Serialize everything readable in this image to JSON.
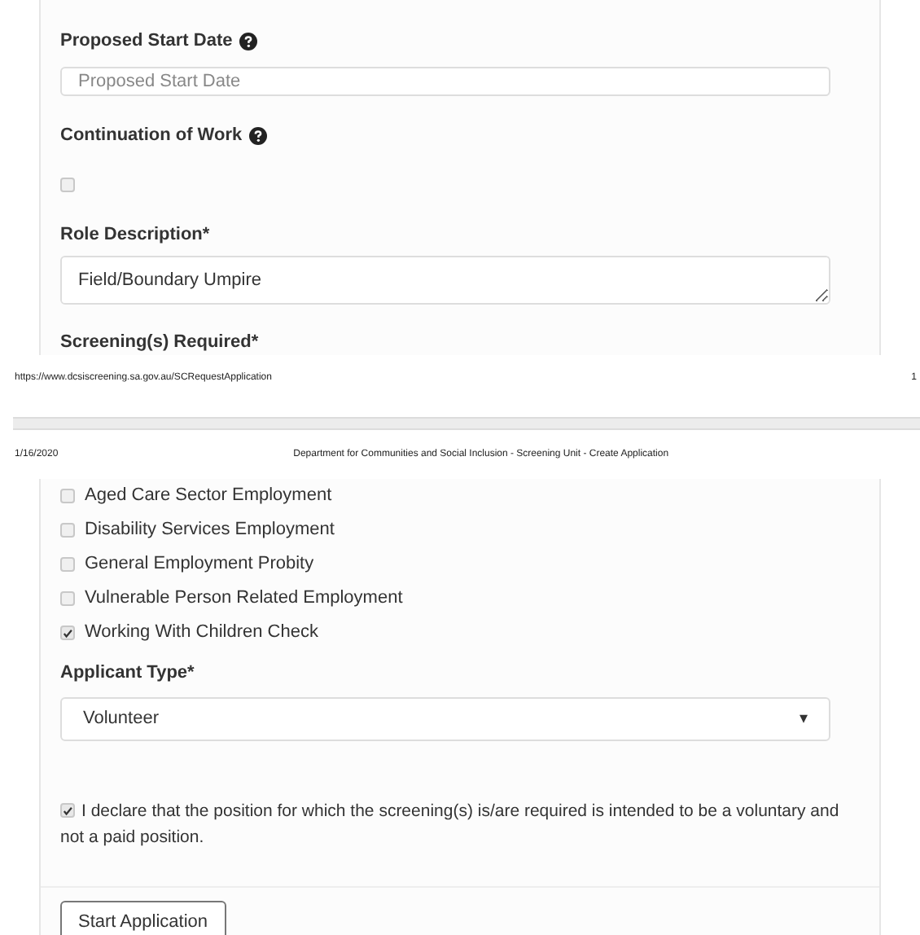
{
  "top_form": {
    "start_date": {
      "label": "Proposed Start Date",
      "placeholder": "Proposed Start Date"
    },
    "continuation": {
      "label": "Continuation of Work",
      "checked": false
    },
    "role": {
      "label": "Role Description*",
      "value": "Field/Boundary Umpire"
    },
    "screenings_label": "Screening(s) Required*"
  },
  "print_footer": {
    "url": "https://www.dcsiscreening.sa.gov.au/SCRequestApplication",
    "page_number": "1"
  },
  "print_header": {
    "date": "1/16/2020",
    "title": "Department for Communities and Social Inclusion - Screening Unit - Create Application"
  },
  "screenings": [
    {
      "label": "Aged Care Sector Employment",
      "checked": false
    },
    {
      "label": "Disability Services Employment",
      "checked": false
    },
    {
      "label": "General Employment Probity",
      "checked": false
    },
    {
      "label": "Vulnerable Person Related Employment",
      "checked": false
    },
    {
      "label": "Working With Children Check",
      "checked": true
    }
  ],
  "applicant_type": {
    "label": "Applicant Type*",
    "value": "Volunteer",
    "caret": "▾"
  },
  "declaration": {
    "text": "I declare that the position for which the screening(s) is/are required is intended to be a voluntary and not a paid position.",
    "checked": true
  },
  "submit": "Start Application"
}
